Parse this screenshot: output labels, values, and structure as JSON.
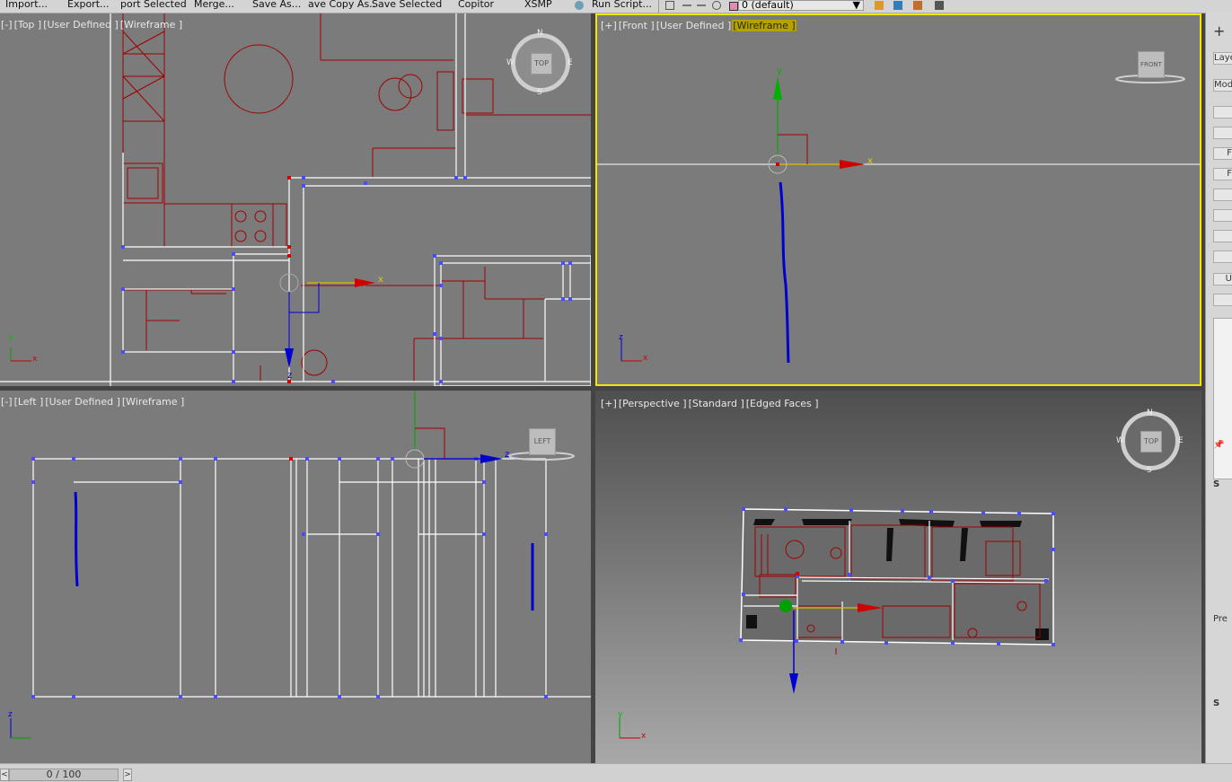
{
  "toolbar": {
    "items": [
      "Import...",
      "Export...",
      "port Selected",
      "Merge...",
      "Save As...",
      "ave Copy As..",
      "Save Selected",
      "Copitor",
      "XSMP",
      "Run Script..."
    ],
    "layer_dropdown": "0 (default)"
  },
  "viewports": {
    "top": {
      "label_plus": "[-]",
      "label_view": "[Top ]",
      "label_cam": "[User Defined ]",
      "label_shade": "[Wireframe ]",
      "compass": {
        "n": "N",
        "s": "S",
        "e": "E",
        "w": "W",
        "cube": "TOP"
      }
    },
    "front": {
      "label_plus": "[+]",
      "label_view": "[Front ]",
      "label_cam": "[User Defined ]",
      "label_shade": "[Wireframe ]",
      "cube": "FRONT"
    },
    "left": {
      "label_plus": "[-]",
      "label_view": "[Left ]",
      "label_cam": "[User Defined ]",
      "label_shade": "[Wireframe ]",
      "cube": "LEFT"
    },
    "perspective": {
      "label_plus": "[+]",
      "label_view": "[Perspective ]",
      "label_cam": "[Standard ]",
      "label_shade": "[Edged Faces ]",
      "compass": {
        "n": "N",
        "s": "S",
        "e": "E",
        "w": "W",
        "cube": "TOP"
      }
    }
  },
  "axes": {
    "x": "x",
    "y": "y",
    "z": "z"
  },
  "side_panel": {
    "items": [
      "+",
      "Laye",
      "Modi",
      "",
      "",
      "F",
      "F",
      "",
      "",
      "",
      "",
      "U",
      "",
      "",
      "S",
      "Pre",
      "S"
    ]
  },
  "timeline": {
    "value": "0 / 100",
    "prev": "<",
    "next": ">"
  },
  "colors": {
    "active_border": "#f0e600",
    "viewport_bg": "#7b7b7b",
    "wire_red": "#a00000",
    "wire_white": "#ffffff",
    "vertex_blue": "#4a4aff",
    "gizmo_red": "#d00000",
    "gizmo_green": "#00b000",
    "gizmo_blue": "#0000d0"
  }
}
